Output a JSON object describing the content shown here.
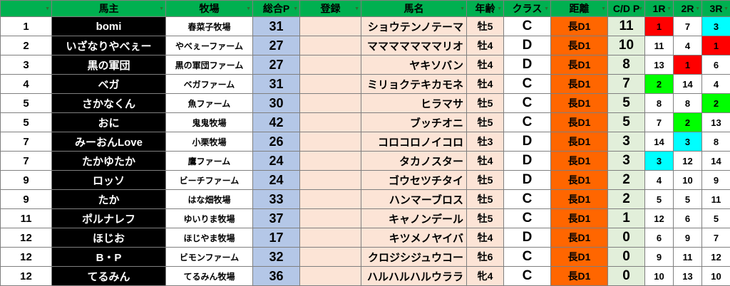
{
  "headers": {
    "rank": "",
    "owner": "馬主",
    "farm": "牧場",
    "total_p": "総合P",
    "register": "登録",
    "horse": "馬名",
    "age": "年齢",
    "class": "クラス",
    "distance": "距離",
    "cd_p": "C/D P",
    "r1": "1R",
    "r2": "2R",
    "r3": "3R"
  },
  "colors": {
    "header": "#00b050",
    "owner_bg": "#000000",
    "total_p_bg": "#b4c7e7",
    "horse_bg": "#fce4d6",
    "distance_bg": "#ff6600",
    "cd_p_bg": "#e2efda",
    "first": "#ff0000",
    "second": "#00ff00",
    "third": "#00ffff"
  },
  "rows": [
    {
      "rank": "1",
      "owner": "bomi",
      "farm": "春菜子牧場",
      "total_p": "31",
      "register": "",
      "horse": "ショウテンノテーマ",
      "age": "牡5",
      "class": "C",
      "distance": "長D1",
      "cd_p": "11",
      "r1": "1",
      "r2": "7",
      "r3": "3",
      "c1": "red",
      "c2": "",
      "c3": "cyan"
    },
    {
      "rank": "2",
      "owner": "いざなりやべぇー",
      "farm": "やべぇーファーム",
      "total_p": "27",
      "register": "",
      "horse": "マママママママリオ",
      "age": "牡4",
      "class": "D",
      "distance": "長D1",
      "cd_p": "10",
      "r1": "11",
      "r2": "4",
      "r3": "1",
      "c1": "",
      "c2": "",
      "c3": "red"
    },
    {
      "rank": "3",
      "owner": "黒の軍団",
      "farm": "黒の軍団ファーム",
      "total_p": "27",
      "register": "",
      "horse": "ヤキソバン",
      "age": "牡4",
      "class": "D",
      "distance": "長D1",
      "cd_p": "8",
      "r1": "13",
      "r2": "1",
      "r3": "6",
      "c1": "",
      "c2": "red",
      "c3": ""
    },
    {
      "rank": "4",
      "owner": "ベガ",
      "farm": "ベガファーム",
      "total_p": "31",
      "register": "",
      "horse": "ミリョクテキカモネ",
      "age": "牡4",
      "class": "C",
      "distance": "長D1",
      "cd_p": "7",
      "r1": "2",
      "r2": "14",
      "r3": "4",
      "c1": "green",
      "c2": "",
      "c3": ""
    },
    {
      "rank": "5",
      "owner": "さかなくん",
      "farm": "魚ファーム",
      "total_p": "30",
      "register": "",
      "horse": "ヒラマサ",
      "age": "牡5",
      "class": "C",
      "distance": "長D1",
      "cd_p": "5",
      "r1": "8",
      "r2": "8",
      "r3": "2",
      "c1": "",
      "c2": "",
      "c3": "green"
    },
    {
      "rank": "5",
      "owner": "おに",
      "farm": "鬼鬼牧場",
      "total_p": "42",
      "register": "",
      "horse": "ブッチオニ",
      "age": "牡5",
      "class": "C",
      "distance": "長D1",
      "cd_p": "5",
      "r1": "7",
      "r2": "2",
      "r3": "13",
      "c1": "",
      "c2": "green",
      "c3": ""
    },
    {
      "rank": "7",
      "owner": "みーおんLove",
      "farm": "小栗牧場",
      "total_p": "26",
      "register": "",
      "horse": "コロコロノイコロ",
      "age": "牡3",
      "class": "D",
      "distance": "長D1",
      "cd_p": "3",
      "r1": "14",
      "r2": "3",
      "r3": "8",
      "c1": "",
      "c2": "cyan",
      "c3": ""
    },
    {
      "rank": "7",
      "owner": "たかゆたか",
      "farm": "鷹ファーム",
      "total_p": "24",
      "register": "",
      "horse": "タカノスター",
      "age": "牡4",
      "class": "D",
      "distance": "長D1",
      "cd_p": "3",
      "r1": "3",
      "r2": "12",
      "r3": "14",
      "c1": "cyan",
      "c2": "",
      "c3": ""
    },
    {
      "rank": "9",
      "owner": "ロッソ",
      "farm": "ビーチファーム",
      "total_p": "24",
      "register": "",
      "horse": "ゴウセツチタイ",
      "age": "牡5",
      "class": "D",
      "distance": "長D1",
      "cd_p": "2",
      "r1": "4",
      "r2": "10",
      "r3": "9",
      "c1": "",
      "c2": "",
      "c3": ""
    },
    {
      "rank": "9",
      "owner": "たか",
      "farm": "はな畑牧場",
      "total_p": "33",
      "register": "",
      "horse": "ハンマーブロス",
      "age": "牡5",
      "class": "C",
      "distance": "長D1",
      "cd_p": "2",
      "r1": "5",
      "r2": "5",
      "r3": "11",
      "c1": "",
      "c2": "",
      "c3": ""
    },
    {
      "rank": "11",
      "owner": "ポルナレフ",
      "farm": "ゆいりま牧場",
      "total_p": "37",
      "register": "",
      "horse": "キャノンデール",
      "age": "牡5",
      "class": "C",
      "distance": "長D1",
      "cd_p": "1",
      "r1": "12",
      "r2": "6",
      "r3": "5",
      "c1": "",
      "c2": "",
      "c3": ""
    },
    {
      "rank": "12",
      "owner": "ほじお",
      "farm": "ほじやま牧場",
      "total_p": "17",
      "register": "",
      "horse": "キツメノヤイバ",
      "age": "牡4",
      "class": "D",
      "distance": "長D1",
      "cd_p": "0",
      "r1": "6",
      "r2": "9",
      "r3": "7",
      "c1": "",
      "c2": "",
      "c3": ""
    },
    {
      "rank": "12",
      "owner": "B・P",
      "farm": "ビモンファーム",
      "total_p": "32",
      "register": "",
      "horse": "クロジシジュウコー",
      "age": "牡6",
      "class": "C",
      "distance": "長D1",
      "cd_p": "0",
      "r1": "9",
      "r2": "11",
      "r3": "12",
      "c1": "",
      "c2": "",
      "c3": ""
    },
    {
      "rank": "12",
      "owner": "てるみん",
      "farm": "てるみん牧場",
      "total_p": "36",
      "register": "",
      "horse": "ハルハルハルウララ",
      "age": "牝4",
      "class": "C",
      "distance": "長D1",
      "cd_p": "0",
      "r1": "10",
      "r2": "13",
      "r3": "10",
      "c1": "",
      "c2": "",
      "c3": ""
    }
  ]
}
